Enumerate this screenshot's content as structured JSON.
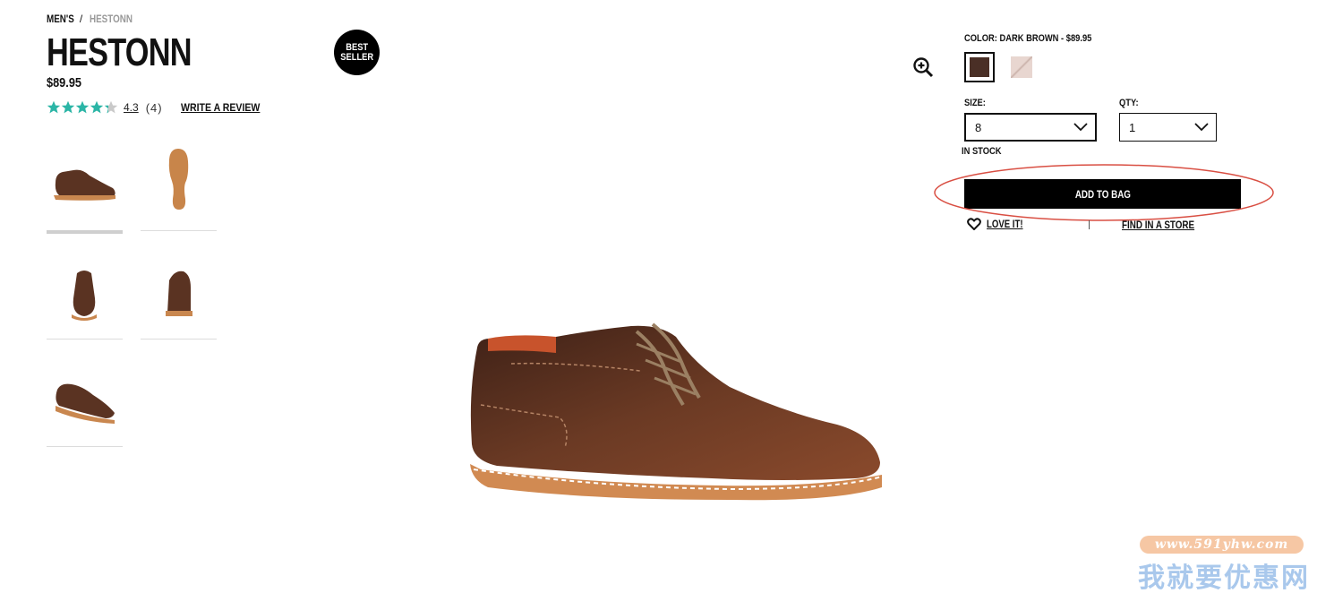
{
  "breadcrumb": {
    "category": "MEN'S",
    "separator": "/",
    "current": "HESTONN"
  },
  "product": {
    "name": "HESTONN",
    "price": "$89.95",
    "rating_value": "4.3",
    "rating_count": "(4)",
    "rating_stars": 4.3,
    "write_review": "WRITE A REVIEW",
    "badge_line1": "BEST",
    "badge_line2": "SELLER"
  },
  "thumbnails": [
    {
      "view": "side",
      "selected": true
    },
    {
      "view": "sole",
      "selected": false
    },
    {
      "view": "front",
      "selected": false
    },
    {
      "view": "back",
      "selected": false
    },
    {
      "view": "angle",
      "selected": false
    }
  ],
  "options": {
    "color_label": "COLOR: DARK BROWN - $89.95",
    "swatches": [
      {
        "name": "dark-brown",
        "color": "#4a2f26",
        "selected": true
      },
      {
        "name": "blush",
        "color": "#e8d6d0",
        "selected": false
      }
    ],
    "size_label": "SIZE:",
    "size_value": "8",
    "qty_label": "QTY:",
    "qty_value": "1",
    "stock_status": "IN STOCK"
  },
  "actions": {
    "add_to_bag": "ADD TO BAG",
    "love": "LOVE IT!",
    "find_store": "FIND IN A STORE"
  },
  "icons": {
    "zoom": "zoom-in-icon",
    "heart": "heart-icon",
    "chevron": "chevron-down-icon",
    "star": "star-icon"
  },
  "colors": {
    "accent_star": "#2bb5a6",
    "button_bg": "#000000",
    "highlight_ellipse": "#d94f43",
    "shoe_leather": "#6b3a24"
  },
  "watermark": {
    "url": "www.591yhw.com",
    "text": "我就要优惠网"
  }
}
